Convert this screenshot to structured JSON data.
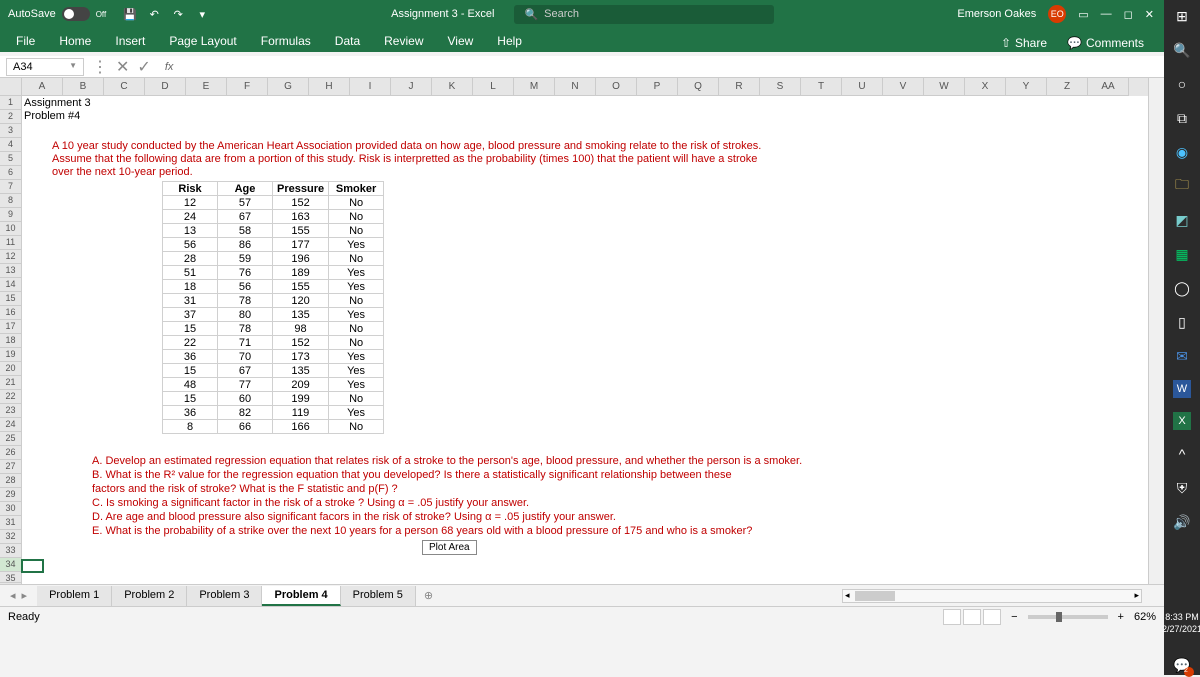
{
  "titlebar": {
    "autosave_label": "AutoSave",
    "autosave_state": "Off",
    "doc_title": "Assignment 3 - Excel",
    "search_placeholder": "Search",
    "user_name": "Emerson Oakes",
    "user_initials": "EO"
  },
  "ribbon": {
    "tabs": [
      "File",
      "Home",
      "Insert",
      "Page Layout",
      "Formulas",
      "Data",
      "Review",
      "View",
      "Help"
    ],
    "active_tab": "Home",
    "share": "Share",
    "comments": "Comments"
  },
  "namebox": {
    "ref": "A34"
  },
  "columns_visible": [
    "A",
    "B",
    "C",
    "D",
    "E",
    "F",
    "G",
    "H",
    "I",
    "J",
    "K",
    "L",
    "M",
    "N",
    "O",
    "P",
    "Q",
    "R",
    "S",
    "T",
    "U",
    "V",
    "W",
    "X",
    "Y",
    "Z",
    "AA"
  ],
  "sheet": {
    "a1": "Assignment 3",
    "a2": "Problem #4",
    "study_lines": [
      "A 10 year study conducted by the American Heart Association provided data on how age, blood pressure and smoking relate to the risk of strokes.",
      "Assume that the following data are from a portion of this study. Risk is interpretted as the probability (times 100) that the patient will have a stroke",
      "over the next 10-year period."
    ],
    "headers": [
      "Risk",
      "Age",
      "Pressure",
      "Smoker"
    ],
    "rows": [
      [
        12,
        57,
        152,
        "No"
      ],
      [
        24,
        67,
        163,
        "No"
      ],
      [
        13,
        58,
        155,
        "No"
      ],
      [
        56,
        86,
        177,
        "Yes"
      ],
      [
        28,
        59,
        196,
        "No"
      ],
      [
        51,
        76,
        189,
        "Yes"
      ],
      [
        18,
        56,
        155,
        "Yes"
      ],
      [
        31,
        78,
        120,
        "No"
      ],
      [
        37,
        80,
        135,
        "Yes"
      ],
      [
        15,
        78,
        98,
        "No"
      ],
      [
        22,
        71,
        152,
        "No"
      ],
      [
        36,
        70,
        173,
        "Yes"
      ],
      [
        15,
        67,
        135,
        "Yes"
      ],
      [
        48,
        77,
        209,
        "Yes"
      ],
      [
        15,
        60,
        199,
        "No"
      ],
      [
        36,
        82,
        119,
        "Yes"
      ],
      [
        8,
        66,
        166,
        "No"
      ]
    ],
    "questions": [
      "A.  Develop an estimated regression equation that relates risk of a stroke to the person's age, blood pressure, and whether the person is a smoker.",
      "B.  What is the R² value for the regression equation that you developed?  Is there a statistically significant relationship between these",
      "        factors and the risk of stroke? What is the F statistic and p(F) ?",
      "C. Is smoking a significant factor in the risk of a stroke ? Using α = .05 justify your answer.",
      "D. Are age and blood pressure also significant facors in the risk of stroke? Using α = .05 justify your answer.",
      "E.  What is the probability of a strike over the next 10 years for a person 68 years old with a blood pressure of 175 and who is a smoker?"
    ],
    "plot_area_label": "Plot Area"
  },
  "sheettabs": {
    "tabs": [
      "Problem 1",
      "Problem 2",
      "Problem 3",
      "Problem 4",
      "Problem 5"
    ],
    "active": "Problem 4"
  },
  "statusbar": {
    "ready": "Ready",
    "zoom": "62%"
  },
  "win": {
    "time": "8:33 PM",
    "date": "2/27/2021"
  }
}
